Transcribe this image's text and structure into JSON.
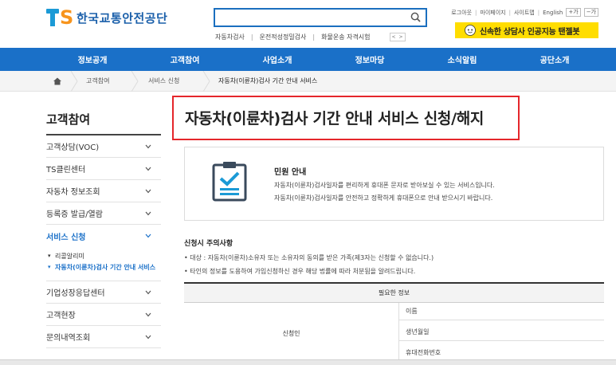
{
  "header": {
    "logo_mark_letter": "S",
    "logo_text": "한국교통안전공단",
    "search": {
      "value": "",
      "placeholder": ""
    },
    "keywords": [
      "자동차검사",
      "운전적성정밀검사",
      "화물운송 자격시험"
    ],
    "keyword_prev": "<",
    "keyword_next": ">",
    "util_links": [
      "로그아웃",
      "마이페이지",
      "사이트맵",
      "English"
    ],
    "zoom_in": "+가",
    "zoom_out": "−가",
    "chatbot_label": "신속한 상담사 인공지능 탠젤봇"
  },
  "gnb": [
    "정보공개",
    "고객참여",
    "사업소개",
    "정보마당",
    "소식알림",
    "공단소개"
  ],
  "breadcrumb": [
    "고객참여",
    "서비스 신청",
    "자동차(이륜차)검사 기간 안내 서비스"
  ],
  "sidebar": {
    "title": "고객참여",
    "items_top": [
      "고객상담(VOC)",
      "TS클린센터",
      "자동차 정보조회",
      "등록증 발급/열람"
    ],
    "active_item": "서비스 신청",
    "sub_items": [
      "리콜알리미",
      "자동차(이륜차)검사 기간 안내 서비스"
    ],
    "sub_bullets": [
      "▾",
      "▾"
    ],
    "items_bottom": [
      "기업성장응답센터",
      "고객현장",
      "문의내역조회"
    ]
  },
  "content": {
    "page_title": "자동차(이륜차)검사 기간 안내 서비스 신청/해지",
    "info": {
      "heading": "민원 안내",
      "lines": [
        "자동차(이륜차)검사일자를 편리하게 휴대폰 문자로 받아보실 수 있는 서비스입니다.",
        "자동차(이륜차)검사일자를 안전하고 정확하게 휴대폰으로 안내 받으시기 바랍니다."
      ]
    },
    "notice": {
      "title": "신청시 주의사항",
      "lines": [
        "• 대상 : 자동차(이륜차)소유자 또는 소유자의 동의를 받은 가족(제3자는 신청할 수 없습니다.)",
        "• 타인의 정보를 도용하여 가입신청하신 경우 해당 법률에 따라 처분됨을 알려드립니다."
      ]
    },
    "table": {
      "header": "필요한 정보",
      "row_label": "신청인",
      "fields": [
        "이름",
        "생년월일",
        "휴대전화번호"
      ]
    }
  },
  "colors": {
    "brand_blue": "#1a70c8",
    "logo_orange": "#f7941d",
    "chatbot_yellow": "#ffdd00",
    "highlight_red": "#e5262b"
  },
  "icons": [
    "search-icon",
    "home-icon",
    "chevron-down-icon",
    "chatbot-icon",
    "document-check-icon"
  ]
}
